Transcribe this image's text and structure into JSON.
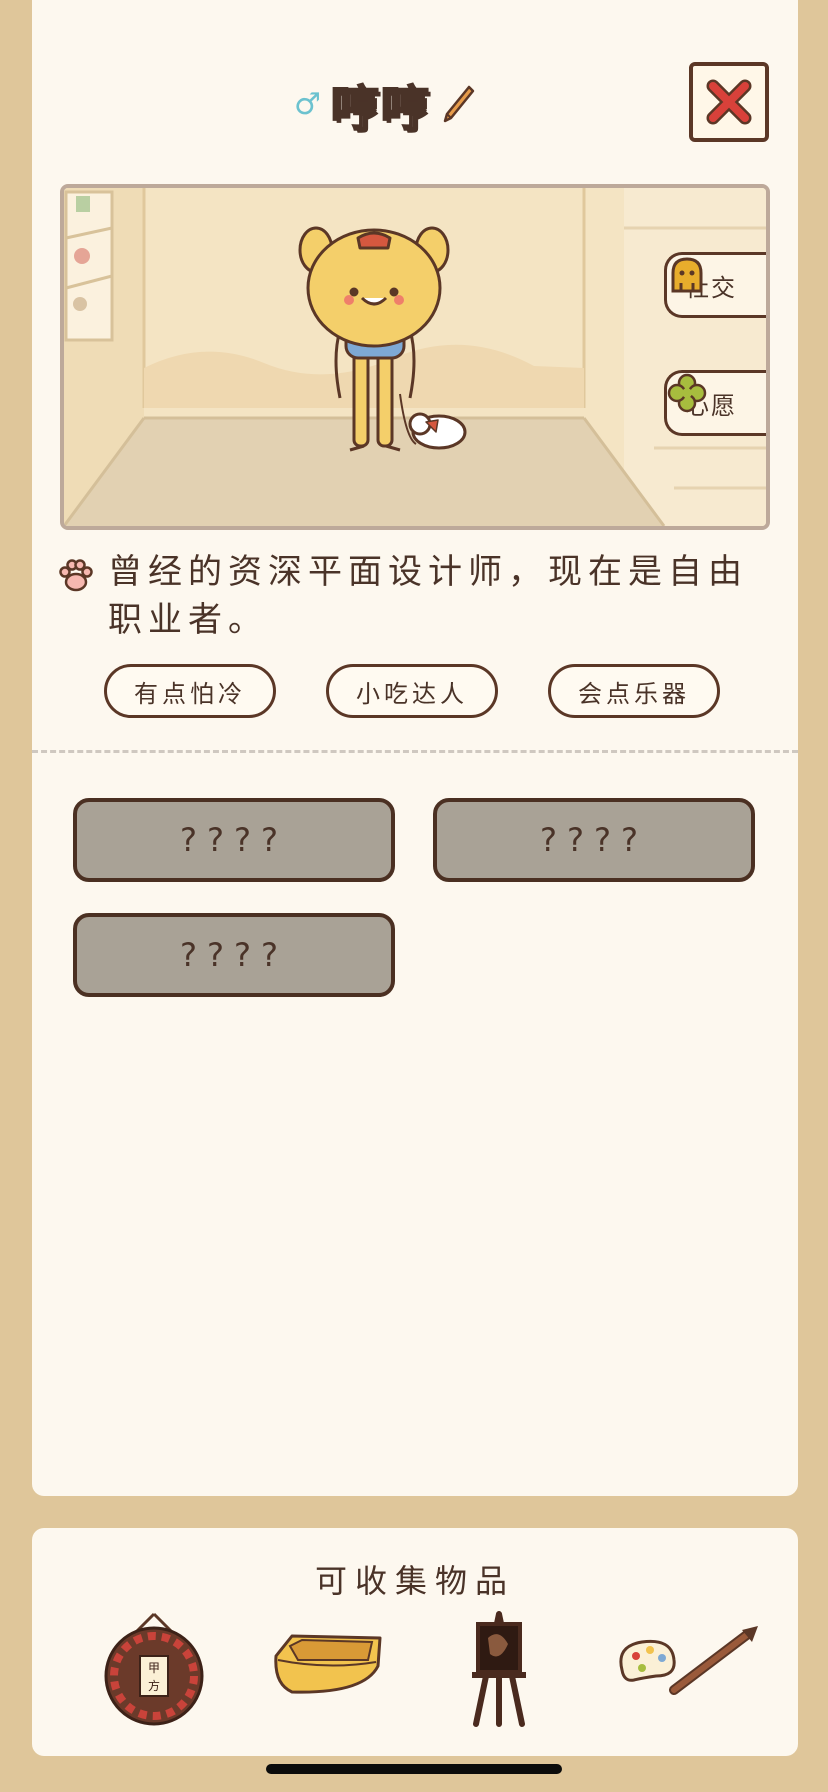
{
  "header": {
    "gender_symbol": "♂",
    "name": "哼哼",
    "edit_icon": "pencil-icon",
    "close_icon": "close-x-icon"
  },
  "scene": {
    "buttons": [
      {
        "label": "社交",
        "icon": "social-icon"
      },
      {
        "label": "心愿",
        "icon": "wish-clover-icon"
      }
    ]
  },
  "profile": {
    "description": "曾经的资深平面设计师，现在是自由职业者。",
    "tags": [
      "有点怕冷",
      "小吃达人",
      "会点乐器"
    ]
  },
  "locked_slots": [
    "????",
    "????",
    "????"
  ],
  "collectibles": {
    "title": "可收集物品",
    "items": [
      "target-sign-icon",
      "tray-icon",
      "easel-icon",
      "palette-brush-icon"
    ]
  },
  "colors": {
    "background": "#dfc69a",
    "card": "#fdf8ef",
    "outline": "#5b3726",
    "close_red": "#d8413a",
    "gender_blue": "#6cc2cf",
    "locked_gray": "#a9a296"
  }
}
